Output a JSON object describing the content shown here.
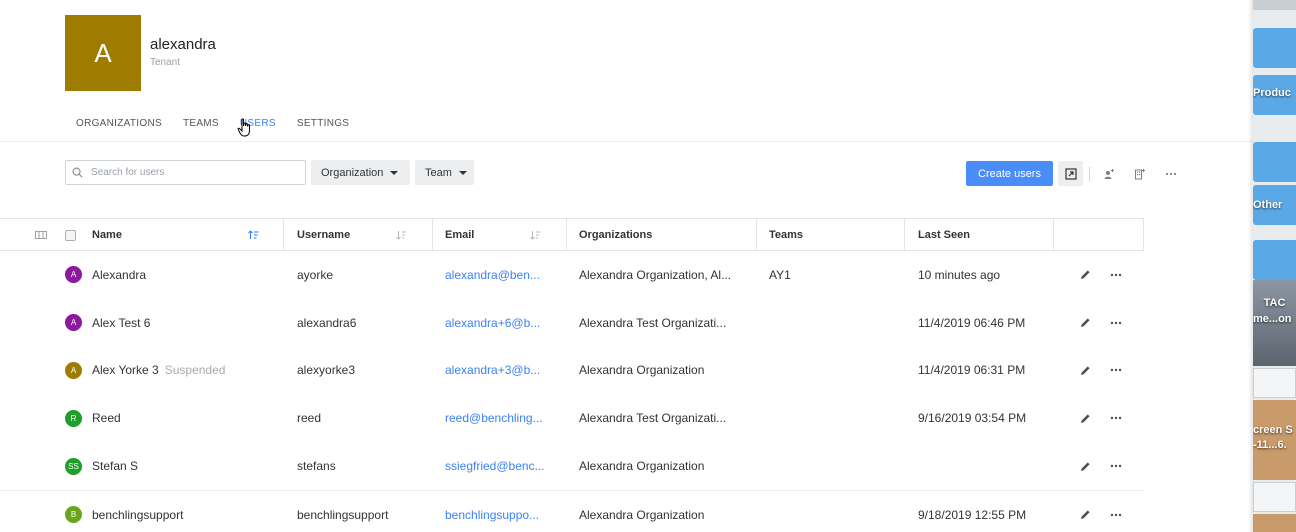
{
  "tenant": {
    "avatar_letter": "A",
    "avatar_color": "#9e7c00",
    "name": "alexandra",
    "role": "Tenant"
  },
  "tabs": [
    {
      "label": "ORGANIZATIONS",
      "active": false
    },
    {
      "label": "TEAMS",
      "active": false
    },
    {
      "label": "USERS",
      "active": true
    },
    {
      "label": "SETTINGS",
      "active": false
    }
  ],
  "toolbar": {
    "search_placeholder": "Search for users",
    "organization_dropdown": "Organization",
    "team_dropdown": "Team",
    "create_button": "Create users"
  },
  "table": {
    "columns": {
      "name": "Name",
      "username": "Username",
      "email": "Email",
      "organizations": "Organizations",
      "teams": "Teams",
      "last_seen": "Last Seen"
    },
    "rows": [
      {
        "avatar": "A",
        "avatar_color": "#8b1a9e",
        "name": "Alexandra",
        "status": "",
        "username": "ayorke",
        "email": "alexandra@ben...",
        "organizations": "Alexandra Organization, Al...",
        "teams": "AY1",
        "last_seen": "10 minutes ago"
      },
      {
        "avatar": "A",
        "avatar_color": "#8b1a9e",
        "name": "Alex Test 6",
        "status": "",
        "username": "alexandra6",
        "email": "alexandra+6@b...",
        "organizations": "Alexandra Test Organizati...",
        "teams": "",
        "last_seen": "11/4/2019 06:46 PM"
      },
      {
        "avatar": "A",
        "avatar_color": "#9e7c00",
        "name": "Alex Yorke 3",
        "status": "Suspended",
        "username": "alexyorke3",
        "email": "alexandra+3@b...",
        "organizations": "Alexandra Organization",
        "teams": "",
        "last_seen": "11/4/2019 06:31 PM"
      },
      {
        "avatar": "R",
        "avatar_color": "#1f9e2a",
        "name": "Reed",
        "status": "",
        "username": "reed",
        "email": "reed@benchling...",
        "organizations": "Alexandra Test Organizati...",
        "teams": "",
        "last_seen": "9/16/2019 03:54 PM"
      },
      {
        "avatar": "SS",
        "avatar_color": "#1f9e2a",
        "name": "Stefan S",
        "status": "",
        "username": "stefans",
        "email": "ssiegfried@benc...",
        "organizations": "Alexandra Organization",
        "teams": "",
        "last_seen": ""
      },
      {
        "avatar": "B",
        "avatar_color": "#6aa51f",
        "name": "benchlingsupport",
        "status": "",
        "username": "benchlingsupport",
        "email": "benchlingsuppo...",
        "organizations": "Alexandra Organization",
        "teams": "",
        "last_seen": "9/18/2019 12:55 PM"
      }
    ]
  },
  "desktop": {
    "labels": [
      "Produc",
      "Other",
      "TAC",
      "me...on",
      "creen S",
      "-11...6."
    ]
  },
  "colors": {
    "accent": "#4b8df8",
    "link": "#3b82f6"
  }
}
